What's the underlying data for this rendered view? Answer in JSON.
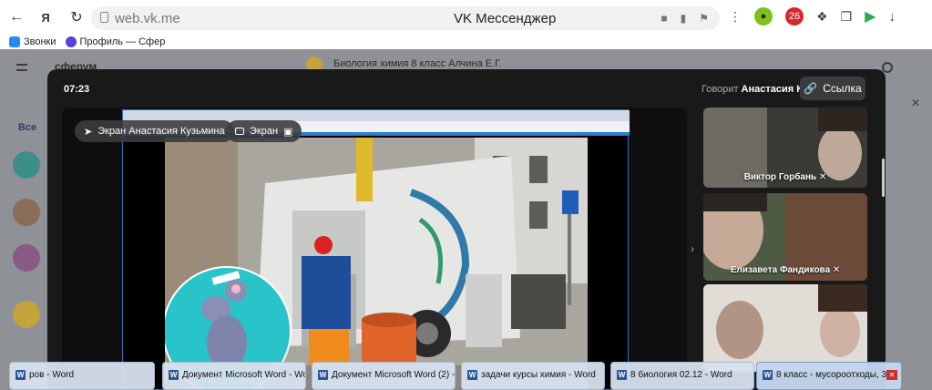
{
  "browser": {
    "url": "web.vk.me",
    "page_title": "VK Мессенджер",
    "bookmarks": [
      {
        "label": "Звонки",
        "color": "#2787f5"
      },
      {
        "label": "Профиль — Сфер",
        "color": "#5b3fd6"
      }
    ]
  },
  "background_app": {
    "logo": "сферум",
    "chat_title": "Биология химия 8 класс Алчина Е.Г.",
    "filter_label": "Все"
  },
  "call": {
    "timer": "07:23",
    "speaking_prefix": "Говорит",
    "speaking_name": "Анастасия К.",
    "link_button": "Ссылка",
    "screen_owner_label": "Экран Анастасия Кузьмина",
    "screen_label": "Экран",
    "participants": [
      {
        "name": "Виктор Горбань"
      },
      {
        "name": "Елизавета Фандикова"
      },
      {
        "name": ""
      }
    ]
  },
  "taskbar": {
    "items": [
      {
        "label": "ров - Word"
      },
      {
        "label": "Документ Microsoft Word - Wo..."
      },
      {
        "label": "Документ Microsoft Word (2) -..."
      },
      {
        "label": "задачи курсы химия - Word"
      },
      {
        "label": "8 биология 02.12 - Word"
      },
      {
        "label": "8 класс - мусороотходы, 3..."
      }
    ]
  },
  "colors": {
    "accent": "#2787f5",
    "call_bg": "#19191a",
    "word_blue": "#2b5797"
  }
}
